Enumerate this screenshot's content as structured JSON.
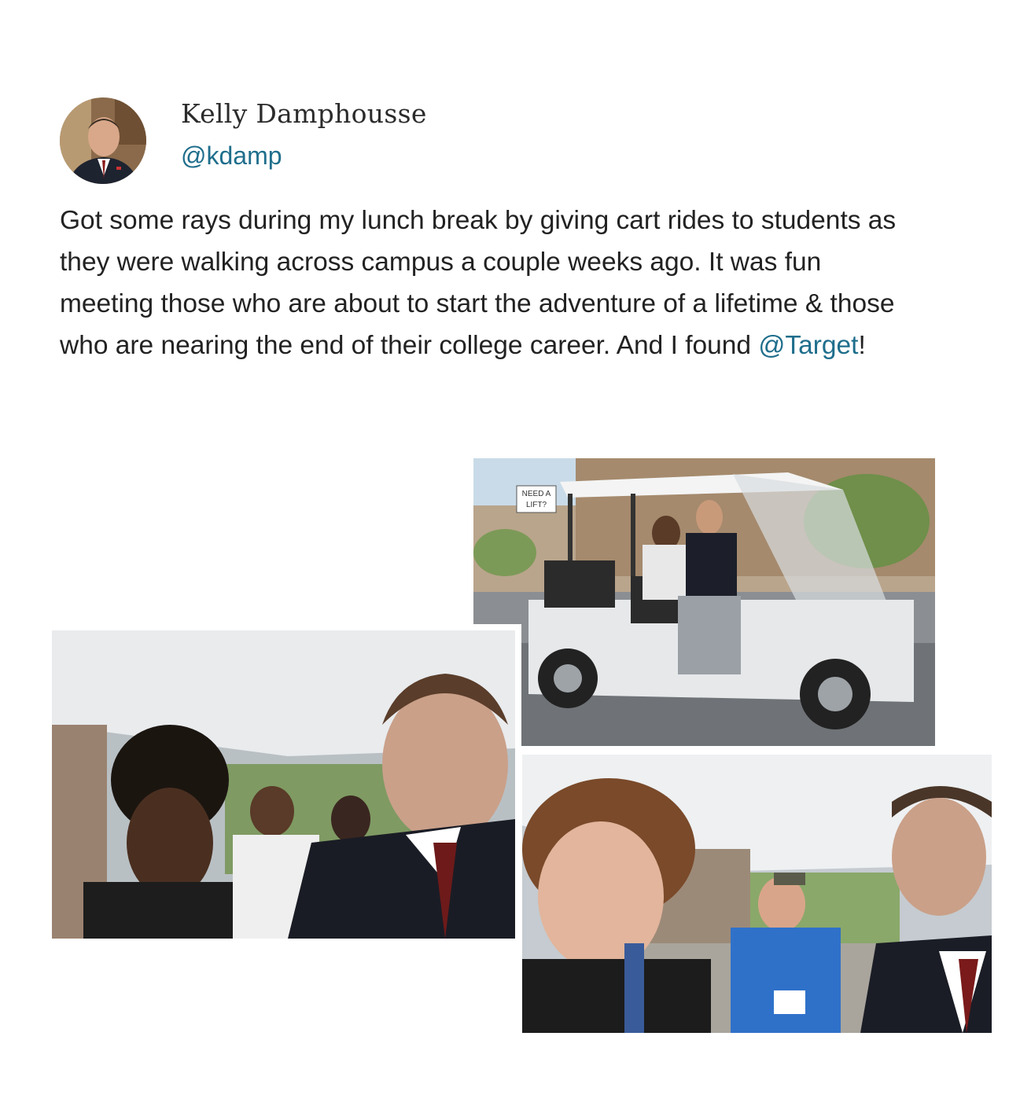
{
  "author": {
    "name": "Kelly Damphousse",
    "handle": "@kdamp",
    "avatar_icon": "profile-photo"
  },
  "tweet": {
    "text_before_mention": "Got some rays during my lunch break by giving cart rides to students as they were walking across campus a couple weeks ago. It was fun meeting those who are about to start the adventure of a lifetime & those who are nearing the end of their college career. And I found ",
    "mention": "@Target",
    "text_after_mention": "!"
  },
  "photos": {
    "cart_sign": [
      "NEED A",
      "LIFT?"
    ]
  },
  "colors": {
    "link": "#1f6e8c",
    "text": "#222222"
  }
}
